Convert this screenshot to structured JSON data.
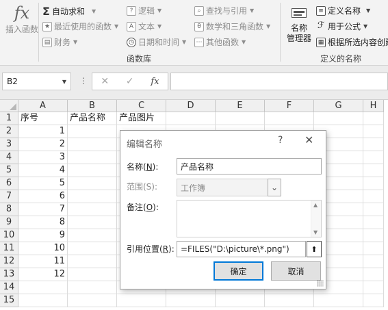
{
  "ribbon": {
    "insert_function": {
      "icon": "fx-icon",
      "label": "插入函数"
    },
    "autosum": "自动求和",
    "recent": "最近使用的函数",
    "financial": "财务",
    "logical": "逻辑",
    "text": "文本",
    "datetime": "日期和时间",
    "lookup": "查找与引用",
    "math": "数学和三角函数",
    "other": "其他函数",
    "function_library": "函数库",
    "name_manager": "名称\n管理器",
    "define_name": "定义名称",
    "use_in_formula": "用于公式",
    "create_from_selection": "根据所选内容创建",
    "defined_names": "定义的名称"
  },
  "formula_bar": {
    "name_box": "B2",
    "fx": "fx",
    "cancel": "✕",
    "enter": "✓",
    "formula": ""
  },
  "grid": {
    "columns": [
      "A",
      "B",
      "C",
      "D",
      "E",
      "F",
      "G",
      "H"
    ],
    "rows": [
      "1",
      "2",
      "3",
      "4",
      "5",
      "6",
      "7",
      "8",
      "9",
      "10",
      "11",
      "12",
      "13",
      "14",
      "15"
    ],
    "header_cells": {
      "A1": "序号",
      "B1": "产品名称",
      "C1": "产品图片"
    },
    "a_values": [
      "1",
      "2",
      "3",
      "4",
      "5",
      "6",
      "7",
      "8",
      "9",
      "10",
      "11",
      "12"
    ]
  },
  "dialog": {
    "title": "编辑名称",
    "help": "?",
    "close": "✕",
    "name_label_pre": "名称(",
    "name_label_key": "N",
    "name_label_post": "):",
    "name_value": "产品名称",
    "scope_label": "范围(S):",
    "scope_value": "工作簿",
    "comment_label_pre": "备注(",
    "comment_label_key": "O",
    "comment_label_post": "):",
    "comment_value": "",
    "refers_label_pre": "引用位置(",
    "refers_label_key": "R",
    "refers_label_post": "):",
    "refers_value": "=FILES(\"D:\\picture\\*.png\")",
    "ok": "确定",
    "cancel": "取消"
  }
}
